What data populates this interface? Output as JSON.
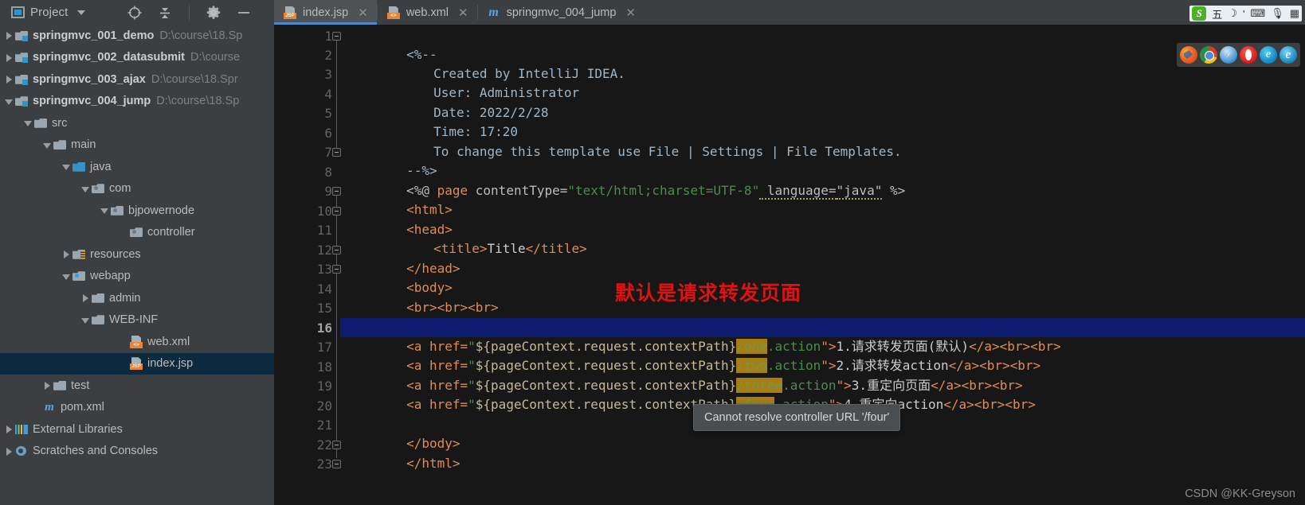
{
  "toolbar": {
    "project_label": "Project",
    "icons": [
      "locate-icon",
      "collapse-all-icon",
      "settings-gear-icon",
      "minimize-icon"
    ]
  },
  "ime": {
    "logo": "S",
    "mode": "五",
    "moon": "☽",
    "comma": "'",
    "keyboard": "⌨",
    "mic": "🎙",
    "grid": "▦"
  },
  "tabs": [
    {
      "label": "index.jsp",
      "icon": "jsp-file-icon",
      "active": true,
      "close": "✕"
    },
    {
      "label": "web.xml",
      "icon": "xml-file-icon",
      "active": false,
      "close": "✕"
    },
    {
      "label": "springmvc_004_jump",
      "icon": "maven-icon",
      "active": false,
      "close": "✕"
    }
  ],
  "sidebar": {
    "items": [
      {
        "name": "springmvc_001_demo",
        "path": "D:\\course\\18.Sp",
        "arrow": "right",
        "icon": "module-folder-icon",
        "indent": 6,
        "bold": true
      },
      {
        "name": "springmvc_002_datasubmit",
        "path": "D:\\course",
        "arrow": "right",
        "icon": "module-folder-icon",
        "indent": 6,
        "bold": true
      },
      {
        "name": "springmvc_003_ajax",
        "path": "D:\\course\\18.Spr",
        "arrow": "right",
        "icon": "module-folder-icon",
        "indent": 6,
        "bold": true
      },
      {
        "name": "springmvc_004_jump",
        "path": "D:\\course\\18.Sp",
        "arrow": "down",
        "icon": "module-folder-icon",
        "indent": 6,
        "bold": true
      },
      {
        "name": "src",
        "path": "",
        "arrow": "down",
        "icon": "folder-icon",
        "indent": 30,
        "bold": false
      },
      {
        "name": "main",
        "path": "",
        "arrow": "down",
        "icon": "folder-icon",
        "indent": 54,
        "bold": false
      },
      {
        "name": "java",
        "path": "",
        "arrow": "down",
        "icon": "source-root-folder-icon",
        "indent": 78,
        "bold": false
      },
      {
        "name": "com",
        "path": "",
        "arrow": "down",
        "icon": "package-icon",
        "indent": 102,
        "bold": false
      },
      {
        "name": "bjpowernode",
        "path": "",
        "arrow": "down",
        "icon": "package-icon",
        "indent": 126,
        "bold": false
      },
      {
        "name": "controller",
        "path": "",
        "arrow": "none",
        "icon": "package-icon",
        "indent": 150,
        "bold": false
      },
      {
        "name": "resources",
        "path": "",
        "arrow": "right",
        "icon": "resources-folder-icon",
        "indent": 78,
        "bold": false
      },
      {
        "name": "webapp",
        "path": "",
        "arrow": "down",
        "icon": "webapp-folder-icon",
        "indent": 78,
        "bold": false
      },
      {
        "name": "admin",
        "path": "",
        "arrow": "right",
        "icon": "folder-icon",
        "indent": 102,
        "bold": false
      },
      {
        "name": "WEB-INF",
        "path": "",
        "arrow": "down",
        "icon": "folder-icon",
        "indent": 102,
        "bold": false
      },
      {
        "name": "web.xml",
        "path": "",
        "arrow": "none",
        "icon": "xml-file-icon",
        "indent": 150,
        "bold": false
      },
      {
        "name": "index.jsp",
        "path": "",
        "arrow": "none",
        "icon": "jsp-file-icon",
        "indent": 150,
        "bold": false,
        "selected": true
      },
      {
        "name": "test",
        "path": "",
        "arrow": "right",
        "icon": "folder-icon",
        "indent": 54,
        "bold": false
      },
      {
        "name": "pom.xml",
        "path": "",
        "arrow": "none",
        "icon": "maven-icon",
        "indent": 54,
        "bold": false
      },
      {
        "name": "External Libraries",
        "path": "",
        "arrow": "right",
        "icon": "libraries-icon",
        "indent": 6,
        "bold": false
      },
      {
        "name": "Scratches and Consoles",
        "path": "",
        "arrow": "right",
        "icon": "scratches-icon",
        "indent": 6,
        "bold": false
      }
    ]
  },
  "editor": {
    "filename": "index.jsp",
    "current_line": 16,
    "line_numbers": [
      1,
      2,
      3,
      4,
      5,
      6,
      7,
      8,
      9,
      10,
      11,
      12,
      13,
      14,
      15,
      16,
      17,
      18,
      19,
      20,
      21,
      22,
      23
    ],
    "lines": [
      {
        "n": 1,
        "text": "<%--"
      },
      {
        "n": 2,
        "text": "  Created by IntelliJ IDEA."
      },
      {
        "n": 3,
        "text": "  User: Administrator"
      },
      {
        "n": 4,
        "text": "  Date: 2022/2/28"
      },
      {
        "n": 5,
        "text": "  Time: 17:20"
      },
      {
        "n": 6,
        "text": "  To change this template use File | Settings | File Templates."
      },
      {
        "n": 7,
        "text": "--%>"
      },
      {
        "n": 8,
        "text": "<%@ page contentType=\"text/html;charset=UTF-8\" language=\"java\" %>"
      },
      {
        "n": 9,
        "text": "<html>"
      },
      {
        "n": 10,
        "text": "<head>"
      },
      {
        "n": 11,
        "text": "    <title>Title</title>"
      },
      {
        "n": 12,
        "text": "</head>"
      },
      {
        "n": 13,
        "text": "<body>"
      },
      {
        "n": 14,
        "text": "<br><br><br>"
      },
      {
        "n": 15,
        "text": "<br>"
      },
      {
        "n": 16,
        "text": "<a href=\"${pageContext.request.contextPath}/one.action\">1.请求转发页面(默认)</a><br><br>"
      },
      {
        "n": 17,
        "text": "<a href=\"${pageContext.request.contextPath}/two.action\">2.请求转发action</a><br><br>"
      },
      {
        "n": 18,
        "text": "<a href=\"${pageContext.request.contextPath}/three.action\">3.重定向页面</a><br><br>"
      },
      {
        "n": 19,
        "text": "<a href=\"${pageContext.request.contextPath}/four.action\">4.重定向action</a><br><br>"
      },
      {
        "n": 20,
        "text": ""
      },
      {
        "n": 21,
        "text": "</body>"
      },
      {
        "n": 22,
        "text": "</html>"
      },
      {
        "n": 23,
        "text": ""
      }
    ],
    "comment_lines": {
      "l1": "<%--",
      "l2": "Created by IntelliJ IDEA.",
      "l3": "User: Administrator",
      "l4": "Date: 2022/2/28",
      "l5": "Time: 17:20",
      "l6": "To change this template use File | Settings | File Templates.",
      "l7": "--%>"
    },
    "directive": {
      "open": "<%@",
      "keyword": "page",
      "attr1": "contentType=",
      "val1": "\"text/html;charset=UTF-8\"",
      "attr2": " language=",
      "val2": "\"java\"",
      "close": " %>"
    },
    "tag_lines": {
      "html_open": "<html>",
      "head_open": "<head>",
      "title": "<title>Title</title>",
      "title_open": "<title>",
      "title_text": "Title",
      "title_close": "</title>",
      "head_close": "</head>",
      "body_open": "<body>",
      "br3": "<br><br><br>",
      "br1": "<br>",
      "body_close": "</body>",
      "html_close": "</html>"
    },
    "links": [
      {
        "tag_open": "<a ",
        "attr": "href=",
        "quote": "\"",
        "el": "${pageContext.request.contextPath}",
        "url": "/one",
        "ext": ".action",
        "quote2": "\">",
        "label": "1.请求转发页面(默认)",
        "tag_close": "</a><br><br>"
      },
      {
        "tag_open": "<a ",
        "attr": "href=",
        "quote": "\"",
        "el": "${pageContext.request.contextPath}",
        "url": "/two",
        "ext": ".action",
        "quote2": "\">",
        "label": "2.请求转发action",
        "tag_close": "</a><br><br>"
      },
      {
        "tag_open": "<a ",
        "attr": "href=",
        "quote": "\"",
        "el": "${pageContext.request.contextPath}",
        "url": "/three",
        "ext": ".action",
        "quote2": "\">",
        "label": "3.重定向页面",
        "tag_close": "</a><br><br>"
      },
      {
        "tag_open": "<a ",
        "attr": "href=",
        "quote": "\"",
        "el": "${pageContext.request.contextPath}",
        "url": "/four",
        "ext": ".action",
        "quote2": "\">",
        "label": "4.重定向action",
        "tag_close": "</a><br><br>"
      }
    ]
  },
  "annotation": {
    "text": "默认是请求转发页面",
    "color": "#e01111"
  },
  "tooltip": {
    "text": "Cannot resolve controller URL '/four'"
  },
  "browsers": [
    "firefox-icon",
    "chrome-icon",
    "safari-icon",
    "opera-icon",
    "edge-icon",
    "ie-icon"
  ],
  "watermark": "CSDN @KK-Greyson",
  "colors": {
    "bg_panel": "#3c3f41",
    "bg_editor": "#171717",
    "selection": "#0d1c6e",
    "tree_selection": "#0d293e",
    "tab_active_underline": "#4a88c7",
    "comment": "#9fb6c9",
    "tag": "#e08c58",
    "string": "#4f8a4f",
    "el_expr": "#c7b898",
    "error_highlight": "#a87d13"
  }
}
